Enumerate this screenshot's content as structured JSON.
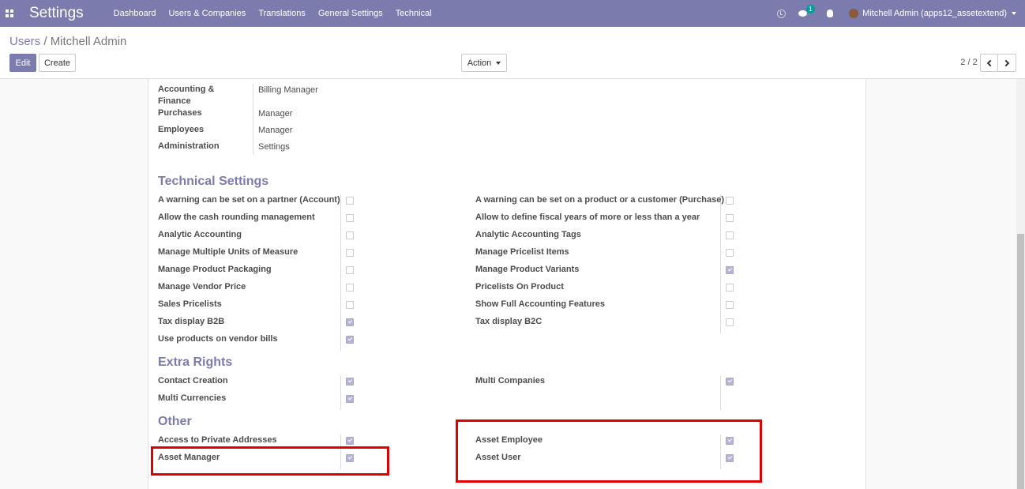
{
  "navbar": {
    "app_title": "Settings",
    "menu": [
      "Dashboard",
      "Users & Companies",
      "Translations",
      "General Settings",
      "Technical"
    ],
    "chat_badge": "1",
    "user": "Mitchell Admin (apps12_assetextend)"
  },
  "breadcrumb": {
    "parent": "Users",
    "separator": "/",
    "current": "Mitchell Admin"
  },
  "toolbar": {
    "edit_label": "Edit",
    "create_label": "Create",
    "action_label": "Action",
    "pager": "2 / 2"
  },
  "app_rights": [
    {
      "app": "Accounting & Finance",
      "value": "Billing Manager"
    },
    {
      "app": "Purchases",
      "value": "Manager"
    },
    {
      "app": "Employees",
      "value": "Manager"
    },
    {
      "app": "Administration",
      "value": "Settings"
    }
  ],
  "technical_settings": {
    "title": "Technical Settings",
    "left": [
      {
        "label": "A warning can be set on a partner (Account)",
        "checked": false
      },
      {
        "label": "Allow the cash rounding management",
        "checked": false
      },
      {
        "label": "Analytic Accounting",
        "checked": false
      },
      {
        "label": "Manage Multiple Units of Measure",
        "checked": false
      },
      {
        "label": "Manage Product Packaging",
        "checked": false
      },
      {
        "label": "Manage Vendor Price",
        "checked": false
      },
      {
        "label": "Sales Pricelists",
        "checked": false
      },
      {
        "label": "Tax display B2B",
        "checked": true
      },
      {
        "label": "Use products on vendor bills",
        "checked": true
      }
    ],
    "right": [
      {
        "label": "A warning can be set on a product or a customer (Purchase)",
        "checked": false
      },
      {
        "label": "Allow to define fiscal years of more or less than a year",
        "checked": false
      },
      {
        "label": "Analytic Accounting Tags",
        "checked": false
      },
      {
        "label": "Manage Pricelist Items",
        "checked": false
      },
      {
        "label": "Manage Product Variants",
        "checked": true
      },
      {
        "label": "Pricelists On Product",
        "checked": false
      },
      {
        "label": "Show Full Accounting Features",
        "checked": false
      },
      {
        "label": "Tax display B2C",
        "checked": false
      }
    ]
  },
  "extra_rights": {
    "title": "Extra Rights",
    "left": [
      {
        "label": "Contact Creation",
        "checked": true
      },
      {
        "label": "Multi Currencies",
        "checked": true
      }
    ],
    "right": [
      {
        "label": "Multi Companies",
        "checked": true
      }
    ]
  },
  "other": {
    "title": "Other",
    "left": [
      {
        "label": "Access to Private Addresses",
        "checked": true
      },
      {
        "label": "Asset Manager",
        "checked": true
      }
    ],
    "right": [
      {
        "label": "Asset Employee",
        "checked": true
      },
      {
        "label": "Asset User",
        "checked": true
      }
    ]
  },
  "colors": {
    "navbar": "#7c7bad",
    "section_title": "#7c7bad",
    "highlight": "#e00000"
  },
  "icons": [
    "apps-icon",
    "clock-icon",
    "chat-icon",
    "bug-icon",
    "avatar",
    "caret-down-icon",
    "chevron-left-icon",
    "chevron-right-icon"
  ]
}
